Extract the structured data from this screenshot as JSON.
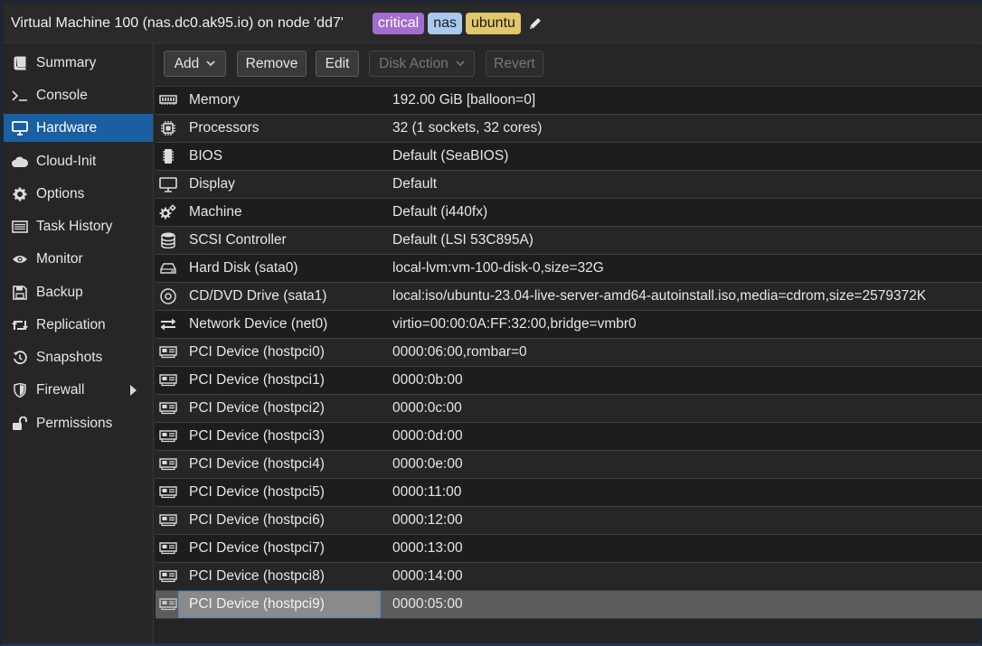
{
  "window": {
    "title": "Virtual Machine 100 (nas.dc0.ak95.io) on node 'dd7'",
    "tags": [
      {
        "label": "critical",
        "bg": "#a36ccf",
        "fg": "#ffffff"
      },
      {
        "label": "nas",
        "bg": "#a9c9ef",
        "fg": "#1a1a1a"
      },
      {
        "label": "ubuntu",
        "bg": "#e2c76b",
        "fg": "#1a1a1a"
      }
    ],
    "edit_icon": "pencil-icon"
  },
  "sidebar": {
    "items": [
      {
        "label": "Summary",
        "icon": "book-icon",
        "active": false
      },
      {
        "label": "Console",
        "icon": "terminal-icon",
        "active": false
      },
      {
        "label": "Hardware",
        "icon": "desktop-icon",
        "active": true
      },
      {
        "label": "Cloud-Init",
        "icon": "cloud-icon",
        "active": false
      },
      {
        "label": "Options",
        "icon": "gear-icon",
        "active": false
      },
      {
        "label": "Task History",
        "icon": "list-icon",
        "active": false
      },
      {
        "label": "Monitor",
        "icon": "eye-icon",
        "active": false
      },
      {
        "label": "Backup",
        "icon": "floppy-icon",
        "active": false
      },
      {
        "label": "Replication",
        "icon": "retweet-icon",
        "active": false
      },
      {
        "label": "Snapshots",
        "icon": "history-icon",
        "active": false
      },
      {
        "label": "Firewall",
        "icon": "shield-icon",
        "active": false
      },
      {
        "label": "Permissions",
        "icon": "unlock-icon",
        "active": false
      }
    ]
  },
  "toolbar": {
    "add_label": "Add",
    "remove_label": "Remove",
    "edit_label": "Edit",
    "disk_action_label": "Disk Action",
    "revert_label": "Revert"
  },
  "hardware": {
    "rows": [
      {
        "name": "Memory",
        "value": "192.00 GiB [balloon=0]",
        "icon": "memory-icon"
      },
      {
        "name": "Processors",
        "value": "32 (1 sockets, 32 cores)",
        "icon": "cpu-icon"
      },
      {
        "name": "BIOS",
        "value": "Default (SeaBIOS)",
        "icon": "microchip-icon"
      },
      {
        "name": "Display",
        "value": "Default",
        "icon": "monitor-icon"
      },
      {
        "name": "Machine",
        "value": "Default (i440fx)",
        "icon": "cogs-icon"
      },
      {
        "name": "SCSI Controller",
        "value": "Default (LSI 53C895A)",
        "icon": "database-icon"
      },
      {
        "name": "Hard Disk (sata0)",
        "value": "local-lvm:vm-100-disk-0,size=32G",
        "icon": "hdd-icon"
      },
      {
        "name": "CD/DVD Drive (sata1)",
        "value": "local:iso/ubuntu-23.04-live-server-amd64-autoinstall.iso,media=cdrom,size=2579372K",
        "icon": "cdrom-icon"
      },
      {
        "name": "Network Device (net0)",
        "value": "virtio=00:00:0A:FF:32:00,bridge=vmbr0",
        "icon": "exchange-icon"
      },
      {
        "name": "PCI Device (hostpci0)",
        "value": "0000:06:00,rombar=0",
        "icon": "pci-card-icon"
      },
      {
        "name": "PCI Device (hostpci1)",
        "value": "0000:0b:00",
        "icon": "pci-card-icon"
      },
      {
        "name": "PCI Device (hostpci2)",
        "value": "0000:0c:00",
        "icon": "pci-card-icon"
      },
      {
        "name": "PCI Device (hostpci3)",
        "value": "0000:0d:00",
        "icon": "pci-card-icon"
      },
      {
        "name": "PCI Device (hostpci4)",
        "value": "0000:0e:00",
        "icon": "pci-card-icon"
      },
      {
        "name": "PCI Device (hostpci5)",
        "value": "0000:11:00",
        "icon": "pci-card-icon"
      },
      {
        "name": "PCI Device (hostpci6)",
        "value": "0000:12:00",
        "icon": "pci-card-icon"
      },
      {
        "name": "PCI Device (hostpci7)",
        "value": "0000:13:00",
        "icon": "pci-card-icon"
      },
      {
        "name": "PCI Device (hostpci8)",
        "value": "0000:14:00",
        "icon": "pci-card-icon"
      },
      {
        "name": "PCI Device (hostpci9)",
        "value": "0000:05:00",
        "icon": "pci-card-icon",
        "selected": true
      }
    ]
  }
}
